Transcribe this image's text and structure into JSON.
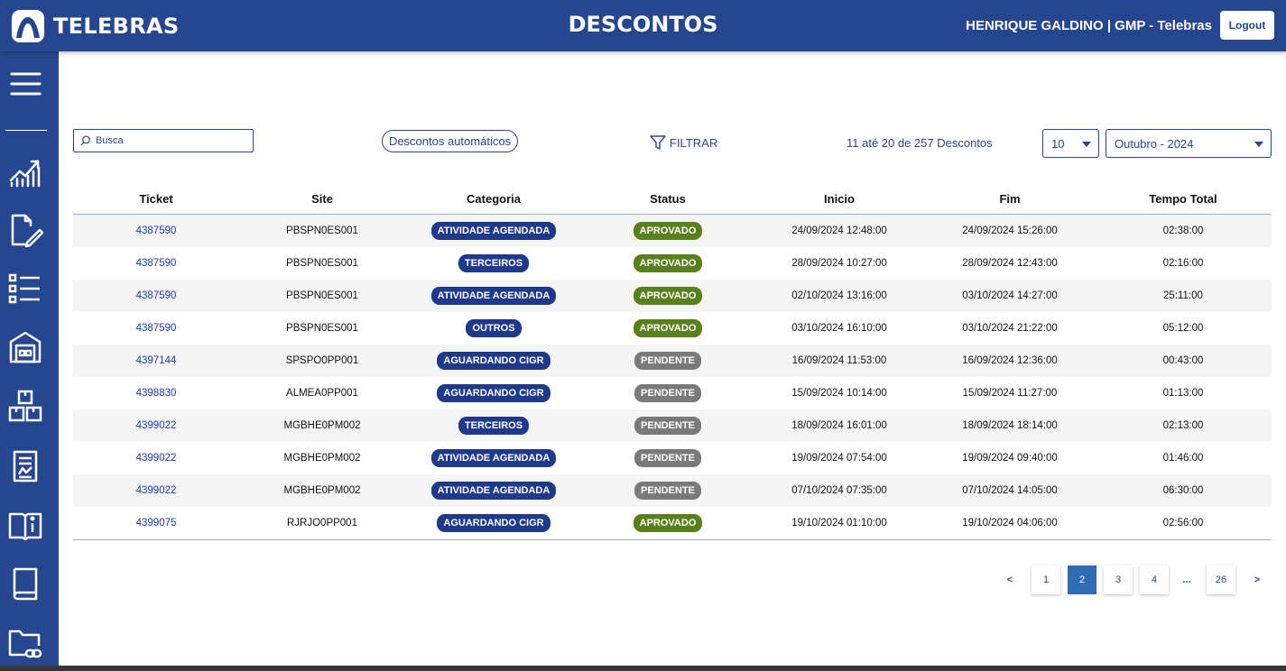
{
  "header": {
    "logo_text": "TELEBRAS",
    "title": "DESCONTOS",
    "user": "HENRIQUE GALDINO | GMP - Telebras",
    "logout_label": "Logout"
  },
  "sidebar": {
    "icons": [
      "menu-icon",
      "chart-icon",
      "document-edit-icon",
      "list-icon",
      "building-icon",
      "boxes-icon",
      "report-icon",
      "book-info-icon",
      "book-icon",
      "folder-link-icon"
    ]
  },
  "toolbar": {
    "search_placeholder": "Busca",
    "auto_discounts_label": "Descontos automáticos",
    "filter_label": "FILTRAR",
    "range_text": "11 até 20 de 257 Descontos",
    "page_size": "10",
    "month": "Outubro - 2024"
  },
  "table": {
    "columns": [
      "Ticket",
      "Site",
      "Categoria",
      "Status",
      "Inicio",
      "Fim",
      "Tempo Total"
    ],
    "rows": [
      {
        "ticket": "4387590",
        "site": "PBSPN0ES001",
        "categoria": "ATIVIDADE AGENDADA",
        "status": "APROVADO",
        "inicio": "24/09/2024 12:48:00",
        "fim": "24/09/2024 15:26:00",
        "tempo": "02:38:00"
      },
      {
        "ticket": "4387590",
        "site": "PBSPN0ES001",
        "categoria": "TERCEIROS",
        "status": "APROVADO",
        "inicio": "28/09/2024 10:27:00",
        "fim": "28/09/2024 12:43:00",
        "tempo": "02:16:00"
      },
      {
        "ticket": "4387590",
        "site": "PBSPN0ES001",
        "categoria": "ATIVIDADE AGENDADA",
        "status": "APROVADO",
        "inicio": "02/10/2024 13:16:00",
        "fim": "03/10/2024 14:27:00",
        "tempo": "25:11:00"
      },
      {
        "ticket": "4387590",
        "site": "PBSPN0ES001",
        "categoria": "OUTROS",
        "status": "APROVADO",
        "inicio": "03/10/2024 16:10:00",
        "fim": "03/10/2024 21:22:00",
        "tempo": "05:12:00"
      },
      {
        "ticket": "4397144",
        "site": "SPSPO0PP001",
        "categoria": "AGUARDANDO CIGR",
        "status": "PENDENTE",
        "inicio": "16/09/2024 11:53:00",
        "fim": "16/09/2024 12:36:00",
        "tempo": "00:43:00"
      },
      {
        "ticket": "4398830",
        "site": "ALMEA0PP001",
        "categoria": "AGUARDANDO CIGR",
        "status": "PENDENTE",
        "inicio": "15/09/2024 10:14:00",
        "fim": "15/09/2024 11:27:00",
        "tempo": "01:13:00"
      },
      {
        "ticket": "4399022",
        "site": "MGBHE0PM002",
        "categoria": "TERCEIROS",
        "status": "PENDENTE",
        "inicio": "18/09/2024 16:01:00",
        "fim": "18/09/2024 18:14:00",
        "tempo": "02:13:00"
      },
      {
        "ticket": "4399022",
        "site": "MGBHE0PM002",
        "categoria": "ATIVIDADE AGENDADA",
        "status": "PENDENTE",
        "inicio": "19/09/2024 07:54:00",
        "fim": "19/09/2024 09:40:00",
        "tempo": "01:46:00"
      },
      {
        "ticket": "4399022",
        "site": "MGBHE0PM002",
        "categoria": "ATIVIDADE AGENDADA",
        "status": "PENDENTE",
        "inicio": "07/10/2024 07:35:00",
        "fim": "07/10/2024 14:05:00",
        "tempo": "06:30:00"
      },
      {
        "ticket": "4399075",
        "site": "RJRJO0PP001",
        "categoria": "AGUARDANDO CIGR",
        "status": "APROVADO",
        "inicio": "19/10/2024 01:10:00",
        "fim": "19/10/2024 04:06:00",
        "tempo": "02:56:00"
      }
    ]
  },
  "pagination": {
    "prev": "<",
    "pages": [
      "1",
      "2",
      "3",
      "4",
      "...",
      "26"
    ],
    "current": "2",
    "next": ">"
  },
  "colors": {
    "brand": "#26468f",
    "approved": "#58801d",
    "pending": "#7a7a7a",
    "category": "#1f3a8a",
    "active_page": "#2f6cb4"
  }
}
